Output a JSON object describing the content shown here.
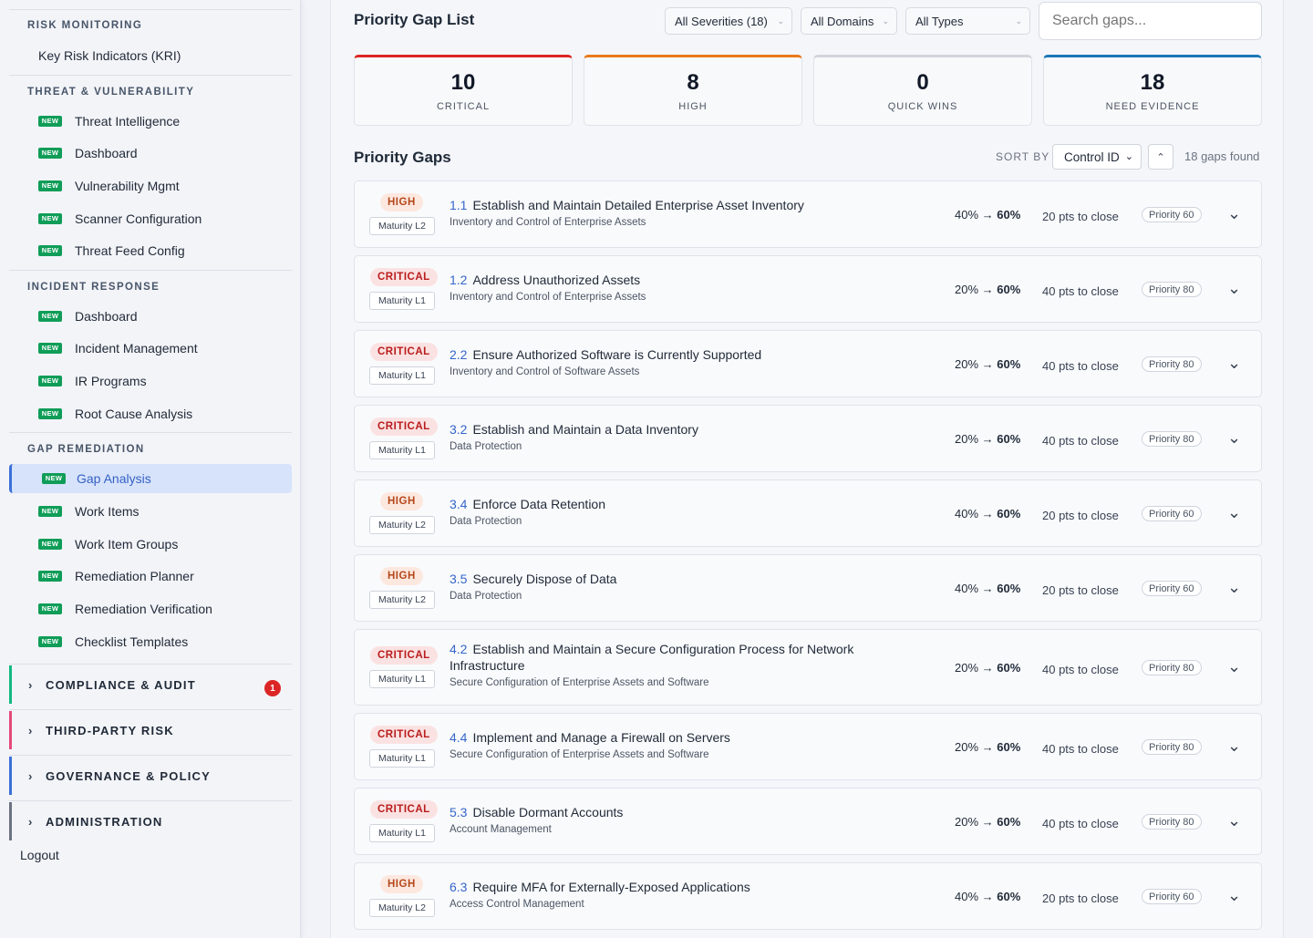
{
  "sidebar": {
    "sections": [
      {
        "title": "RISK MONITORING",
        "items": [
          {
            "label": "Key Risk Indicators (KRI)",
            "new": false
          }
        ]
      },
      {
        "title": "THREAT & VULNERABILITY",
        "items": [
          {
            "label": "Threat Intelligence",
            "new": true
          },
          {
            "label": "Dashboard",
            "new": true
          },
          {
            "label": "Vulnerability Mgmt",
            "new": true
          },
          {
            "label": "Scanner Configuration",
            "new": true
          },
          {
            "label": "Threat Feed Config",
            "new": true
          }
        ]
      },
      {
        "title": "INCIDENT RESPONSE",
        "items": [
          {
            "label": "Dashboard",
            "new": true
          },
          {
            "label": "Incident Management",
            "new": true
          },
          {
            "label": "IR Programs",
            "new": true
          },
          {
            "label": "Root Cause Analysis",
            "new": true
          }
        ]
      },
      {
        "title": "GAP REMEDIATION",
        "items": [
          {
            "label": "Gap Analysis",
            "new": true,
            "active": true
          },
          {
            "label": "Work Items",
            "new": true
          },
          {
            "label": "Work Item Groups",
            "new": true
          },
          {
            "label": "Remediation Planner",
            "new": true
          },
          {
            "label": "Remediation Verification",
            "new": true
          },
          {
            "label": "Checklist Templates",
            "new": true
          }
        ]
      }
    ],
    "new_badge": "NEW",
    "groups": [
      {
        "label": "COMPLIANCE & AUDIT",
        "accent": "#10b981",
        "count": "1"
      },
      {
        "label": "THIRD-PARTY RISK",
        "accent": "#e5487a"
      },
      {
        "label": "GOVERNANCE & POLICY",
        "accent": "#3b6fd8"
      },
      {
        "label": "ADMINISTRATION",
        "accent": "#6b7280"
      }
    ],
    "logout": "Logout"
  },
  "header": {
    "title": "Priority Gap List",
    "filters": [
      "All Severities (18)",
      "All Domains",
      "All Types"
    ],
    "search_placeholder": "Search gaps..."
  },
  "stats": [
    {
      "value": "10",
      "label": "CRITICAL",
      "color": "#dc2626"
    },
    {
      "value": "8",
      "label": "HIGH",
      "color": "#ea7a1c"
    },
    {
      "value": "0",
      "label": "QUICK WINS",
      "color": "#d1d5db"
    },
    {
      "value": "18",
      "label": "NEED EVIDENCE",
      "color": "#1d77b8"
    }
  ],
  "list": {
    "title": "Priority Gaps",
    "sort_label": "SORT BY",
    "sort_value": "Control ID",
    "found": "18 gaps found"
  },
  "gaps": [
    {
      "severity": "HIGH",
      "maturity": "Maturity L2",
      "id": "1.1",
      "title": "Establish and Maintain Detailed Enterprise Asset Inventory",
      "domain": "Inventory and Control of Enterprise Assets",
      "from": "40%",
      "to": "60%",
      "pts": "20 pts to close",
      "priority": "Priority 60"
    },
    {
      "severity": "CRITICAL",
      "maturity": "Maturity L1",
      "id": "1.2",
      "title": "Address Unauthorized Assets",
      "domain": "Inventory and Control of Enterprise Assets",
      "from": "20%",
      "to": "60%",
      "pts": "40 pts to close",
      "priority": "Priority 80"
    },
    {
      "severity": "CRITICAL",
      "maturity": "Maturity L1",
      "id": "2.2",
      "title": "Ensure Authorized Software is Currently Supported",
      "domain": "Inventory and Control of Software Assets",
      "from": "20%",
      "to": "60%",
      "pts": "40 pts to close",
      "priority": "Priority 80"
    },
    {
      "severity": "CRITICAL",
      "maturity": "Maturity L1",
      "id": "3.2",
      "title": "Establish and Maintain a Data Inventory",
      "domain": "Data Protection",
      "from": "20%",
      "to": "60%",
      "pts": "40 pts to close",
      "priority": "Priority 80"
    },
    {
      "severity": "HIGH",
      "maturity": "Maturity L2",
      "id": "3.4",
      "title": "Enforce Data Retention",
      "domain": "Data Protection",
      "from": "40%",
      "to": "60%",
      "pts": "20 pts to close",
      "priority": "Priority 60"
    },
    {
      "severity": "HIGH",
      "maturity": "Maturity L2",
      "id": "3.5",
      "title": "Securely Dispose of Data",
      "domain": "Data Protection",
      "from": "40%",
      "to": "60%",
      "pts": "20 pts to close",
      "priority": "Priority 60"
    },
    {
      "severity": "CRITICAL",
      "maturity": "Maturity L1",
      "id": "4.2",
      "title": "Establish and Maintain a Secure Configuration Process for Network Infrastructure",
      "domain": "Secure Configuration of Enterprise Assets and Software",
      "from": "20%",
      "to": "60%",
      "pts": "40 pts to close",
      "priority": "Priority 80"
    },
    {
      "severity": "CRITICAL",
      "maturity": "Maturity L1",
      "id": "4.4",
      "title": "Implement and Manage a Firewall on Servers",
      "domain": "Secure Configuration of Enterprise Assets and Software",
      "from": "20%",
      "to": "60%",
      "pts": "40 pts to close",
      "priority": "Priority 80"
    },
    {
      "severity": "CRITICAL",
      "maturity": "Maturity L1",
      "id": "5.3",
      "title": "Disable Dormant Accounts",
      "domain": "Account Management",
      "from": "20%",
      "to": "60%",
      "pts": "40 pts to close",
      "priority": "Priority 80"
    },
    {
      "severity": "HIGH",
      "maturity": "Maturity L2",
      "id": "6.3",
      "title": "Require MFA for Externally-Exposed Applications",
      "domain": "Access Control Management",
      "from": "40%",
      "to": "60%",
      "pts": "20 pts to close",
      "priority": "Priority 60"
    }
  ]
}
